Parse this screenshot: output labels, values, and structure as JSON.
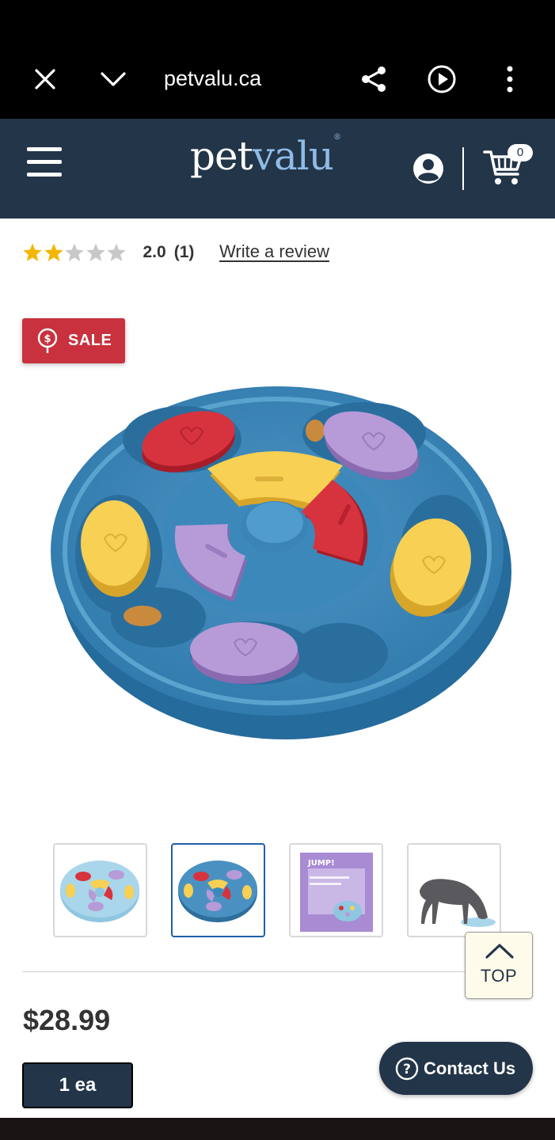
{
  "browser": {
    "url": "petvalu.ca",
    "icons": [
      "close-icon",
      "chevron-down-icon",
      "share-icon",
      "play-icon",
      "more-vertical-icon"
    ]
  },
  "header": {
    "logo_pet": "pet",
    "logo_valu": "valu",
    "cart_count": "0",
    "icons": [
      "menu-icon",
      "account-icon",
      "cart-icon"
    ],
    "colors": {
      "background": "#233548",
      "logo_accent": "#8fbbe6"
    }
  },
  "rating": {
    "stars": 2,
    "max_stars": 5,
    "score": "2.0",
    "count": "(1)",
    "write_review": "Write a review",
    "colors": {
      "filled": "#f2b705",
      "empty": "#c8c8c8"
    }
  },
  "sale_badge": {
    "label": "SALE",
    "color": "#c8313d"
  },
  "thumbnails": {
    "count": 4,
    "selected_index": 1,
    "box_brand": "JUMP!"
  },
  "top_button": {
    "label": "TOP"
  },
  "price": "$28.99",
  "unit_button": "1 ea",
  "contact_button": "Contact Us"
}
